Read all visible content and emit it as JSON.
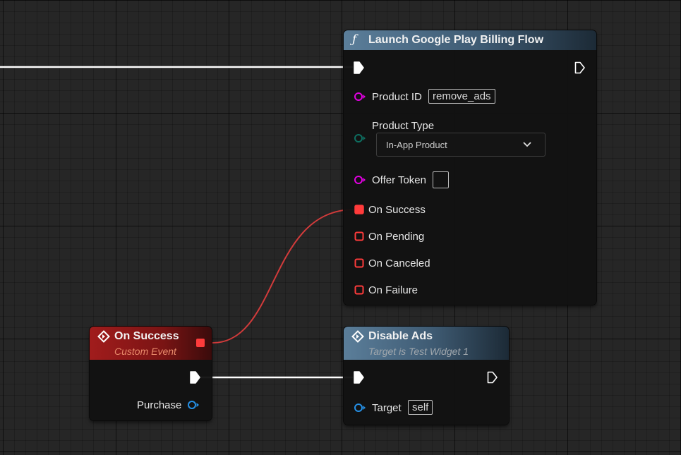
{
  "colors": {
    "exec_wire": "#ffffff",
    "delegate_wire": "#d23b3b",
    "delegate_pin": "#ff3b3b",
    "string_pin": "#e100e1",
    "enum_pin": "#0e6e60",
    "object_pin": "#2590e6",
    "subtitle_blue": "#a0a7ad",
    "subtitle_red": "#e88a6a"
  },
  "launch_node": {
    "icon": "function-icon",
    "icon_glyph": "ƒ",
    "title": "Launch Google Play Billing Flow",
    "product_id_label": "Product ID",
    "product_id_value": "remove_ads",
    "product_type_label": "Product Type",
    "product_type_value": "In-App Product",
    "offer_token_label": "Offer Token",
    "offer_token_value": "",
    "on_success_label": "On Success",
    "on_pending_label": "On Pending",
    "on_canceled_label": "On Canceled",
    "on_failure_label": "On Failure"
  },
  "event_node": {
    "icon": "event-diamond-icon",
    "title": "On Success",
    "subtitle": "Custom Event",
    "purchase_label": "Purchase"
  },
  "disable_node": {
    "icon": "function-diamond-icon",
    "title": "Disable Ads",
    "subtitle": "Target is Test Widget 1",
    "target_label": "Target",
    "target_value": "self"
  }
}
